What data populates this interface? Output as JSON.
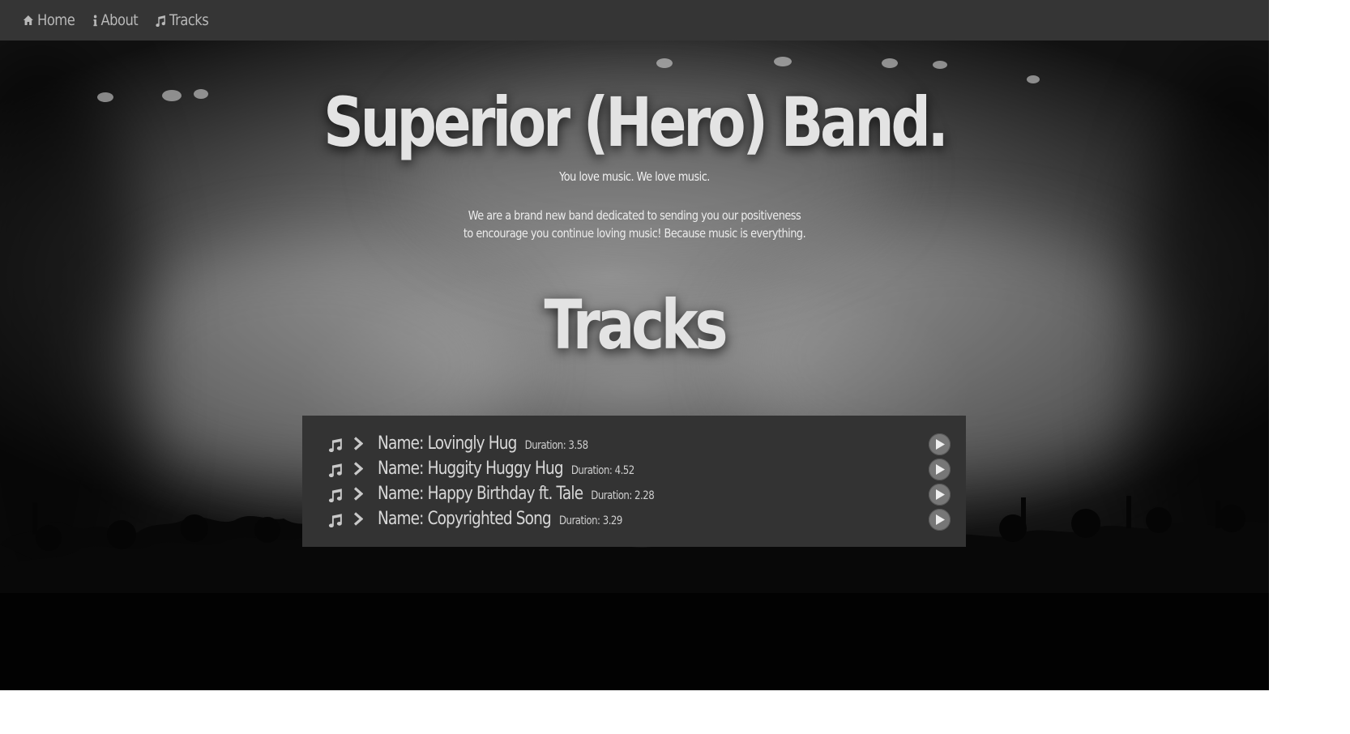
{
  "nav": {
    "items": [
      {
        "label": "Home",
        "icon": "home-icon"
      },
      {
        "label": "About",
        "icon": "info-icon"
      },
      {
        "label": "Tracks",
        "icon": "music-note-icon"
      }
    ]
  },
  "hero": {
    "title": "Superior (Hero) Band.",
    "tagline": "You love music. We love music.",
    "description_line1": "We are a brand new band dedicated to sending you our positiveness",
    "description_line2": "to encourage you continue loving music! Because music is everything."
  },
  "tracks_section": {
    "heading": "Tracks",
    "items": [
      {
        "name": "Name: Lovingly Hug",
        "duration": "Duration: 3.58"
      },
      {
        "name": "Name: Huggity Huggy Hug",
        "duration": "Duration: 4.52"
      },
      {
        "name": "Name: Happy Birthday ft. Tale",
        "duration": "Duration: 2.28"
      },
      {
        "name": "Name: Copyrighted Song",
        "duration": "Duration: 3.29"
      }
    ]
  },
  "colors": {
    "navbar_bg": "#353535",
    "nav_text": "#b9b9b9",
    "panel_bg": "#333333",
    "heading_text": "#e3e3e3",
    "play_button": "#777777"
  }
}
